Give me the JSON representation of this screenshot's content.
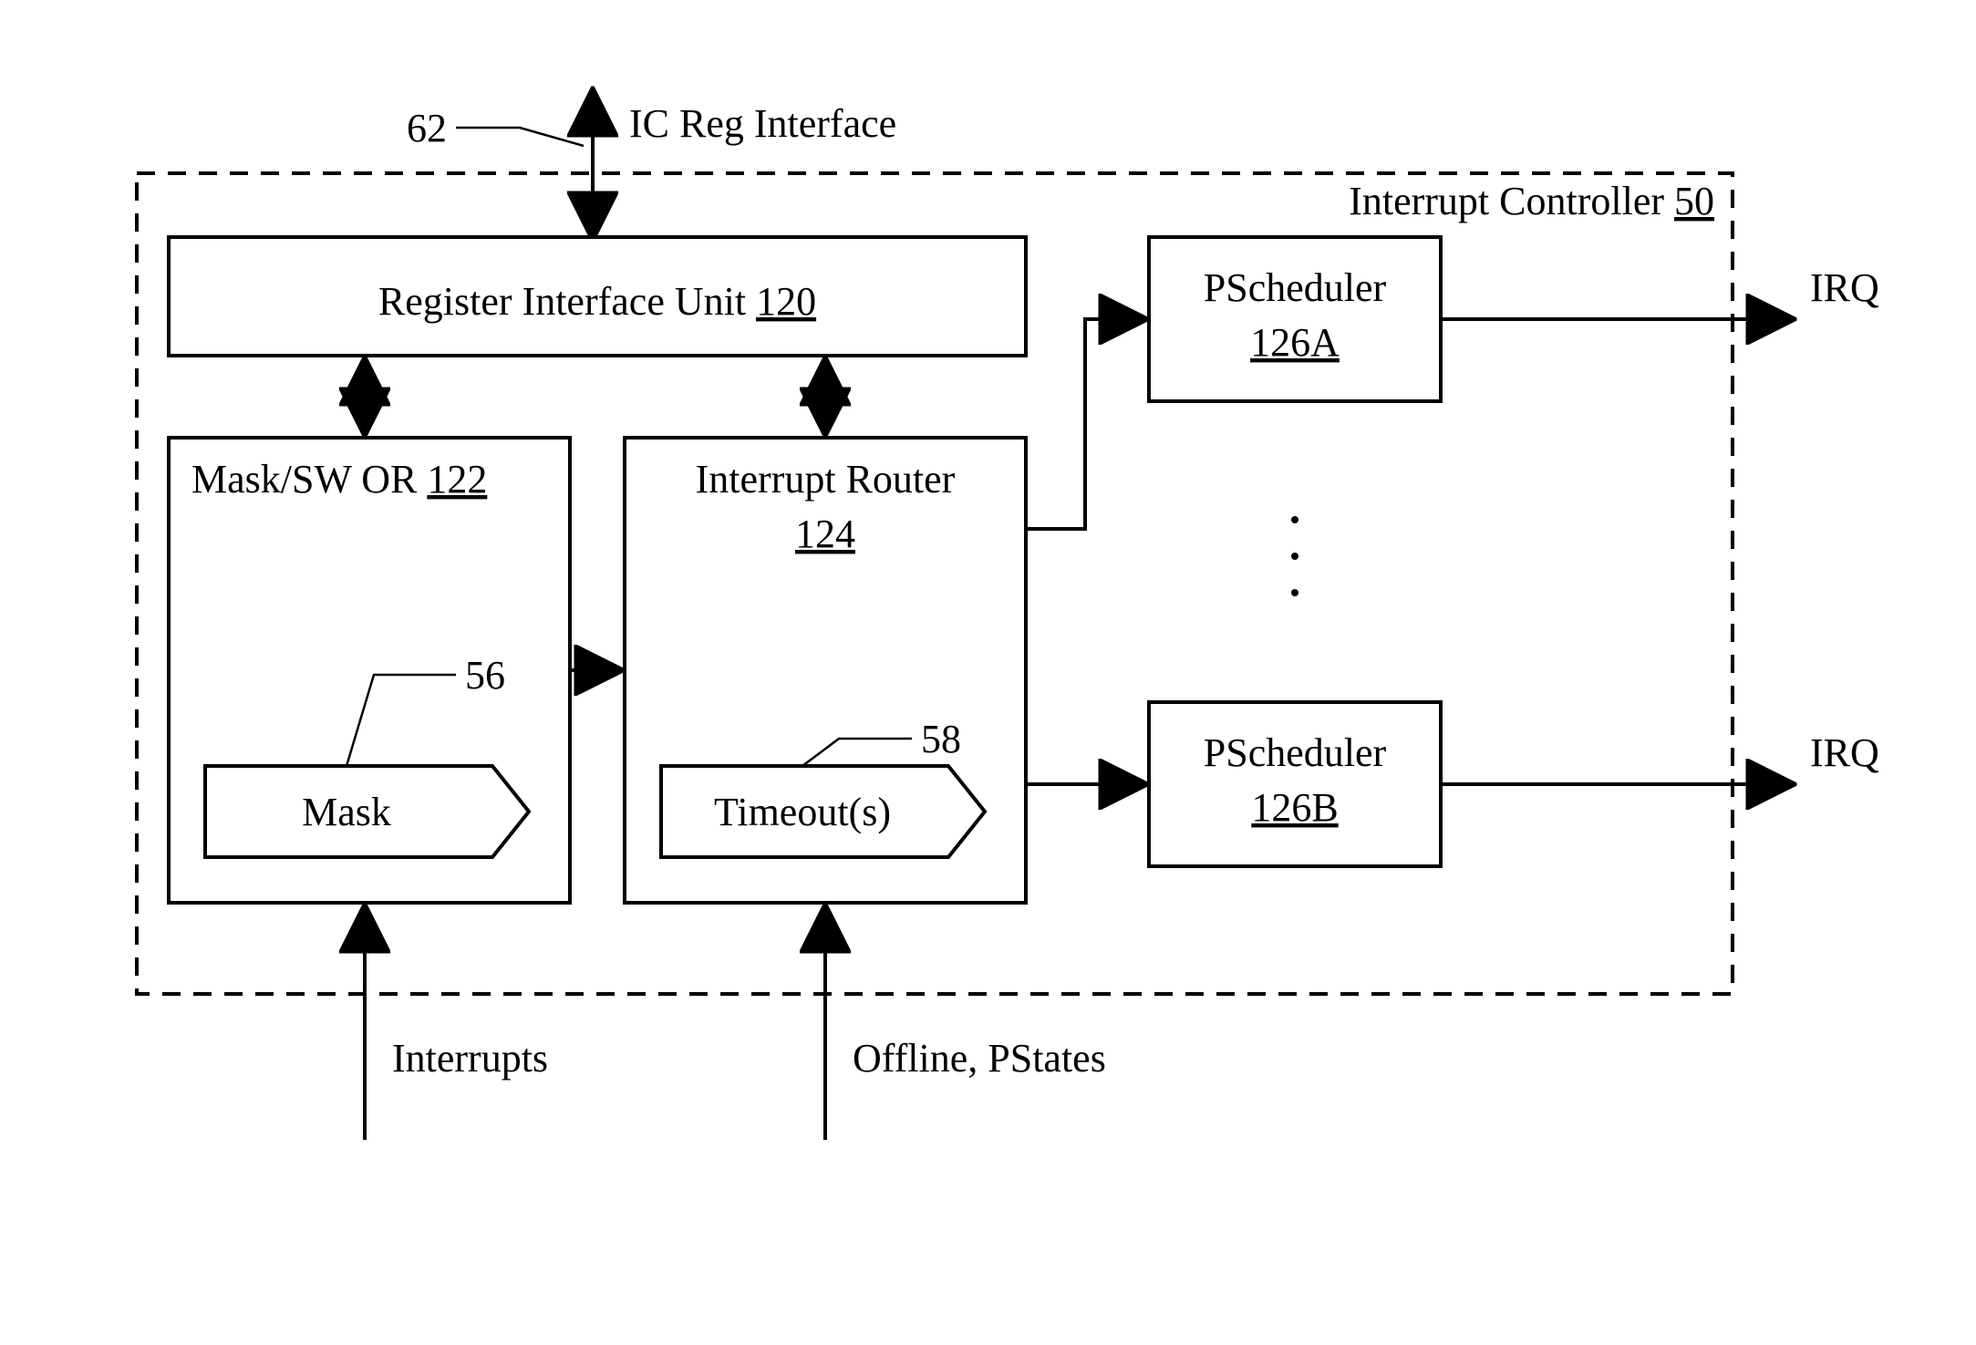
{
  "title": {
    "ref62": "62",
    "icreg": "IC Reg Interface"
  },
  "controller": {
    "label": "Interrupt Controller ",
    "num": "50"
  },
  "regiface": {
    "label": "Register Interface Unit ",
    "num": "120"
  },
  "masksw": {
    "label": "Mask/SW OR ",
    "num": "122"
  },
  "router": {
    "label": "Interrupt Router",
    "num": "124"
  },
  "mask": {
    "label": "Mask",
    "ref": "56"
  },
  "timeouts": {
    "label": "Timeout(s)",
    "ref": "58"
  },
  "pschedA": {
    "label": "PScheduler",
    "num": "126A"
  },
  "pschedB": {
    "label": "PScheduler",
    "num": "126B"
  },
  "irq": {
    "a": "IRQ",
    "b": "IRQ"
  },
  "inputs": {
    "interrupts": "Interrupts",
    "offline": "Offline, PStates"
  }
}
